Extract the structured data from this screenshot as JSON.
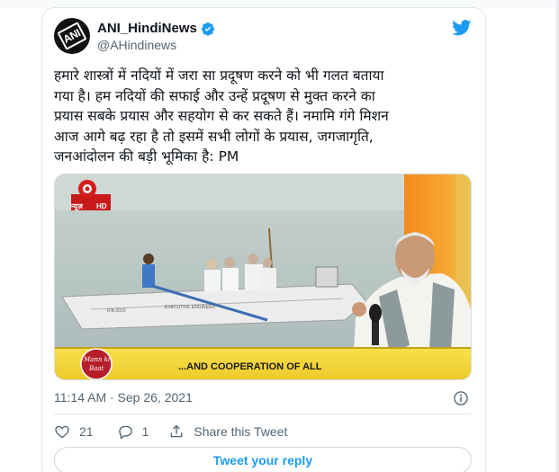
{
  "account": {
    "display_name": "ANI_HindiNews",
    "handle": "@AHindinews",
    "avatar_text": "ANI",
    "verified": true
  },
  "tweet": {
    "text": "हमारे शास्त्रों में नदियों में जरा सा प्रदूषण करने को भी गलत बताया\nगया है। हम नदियों की सफाई और उन्हें प्रदूषण से मुक्त करने का\nप्रयास सबके प्रयास और सहयोग से कर सकते हैं। नमामि गंगे मिशन\nआज आगे बढ़ रहा है तो इसमें सभी लोगों के प्रयास, जगजागृति,\nजनआंदोलन की बड़ी भूमिका है: PM",
    "timestamp": "11:14 AM · Sep 26, 2021"
  },
  "media": {
    "channel_logo_text": "न्यूज़",
    "channel_hd": "HD",
    "caption": "...AND COOPERATION OF ALL",
    "show_logo_line1": "Mann ki",
    "show_logo_line2": "Baat",
    "boat_label_left": "IFB-2010",
    "boat_label_right": "EXECUTIVE ENGINEER"
  },
  "actions": {
    "likes": "21",
    "replies": "1",
    "share_label": "Share this Tweet"
  },
  "reply_button_label": "Tweet your reply",
  "colors": {
    "accent": "#1d9bf0",
    "muted": "#536471",
    "border": "#e1e8ed",
    "caption_bar": "#f5d93a"
  }
}
